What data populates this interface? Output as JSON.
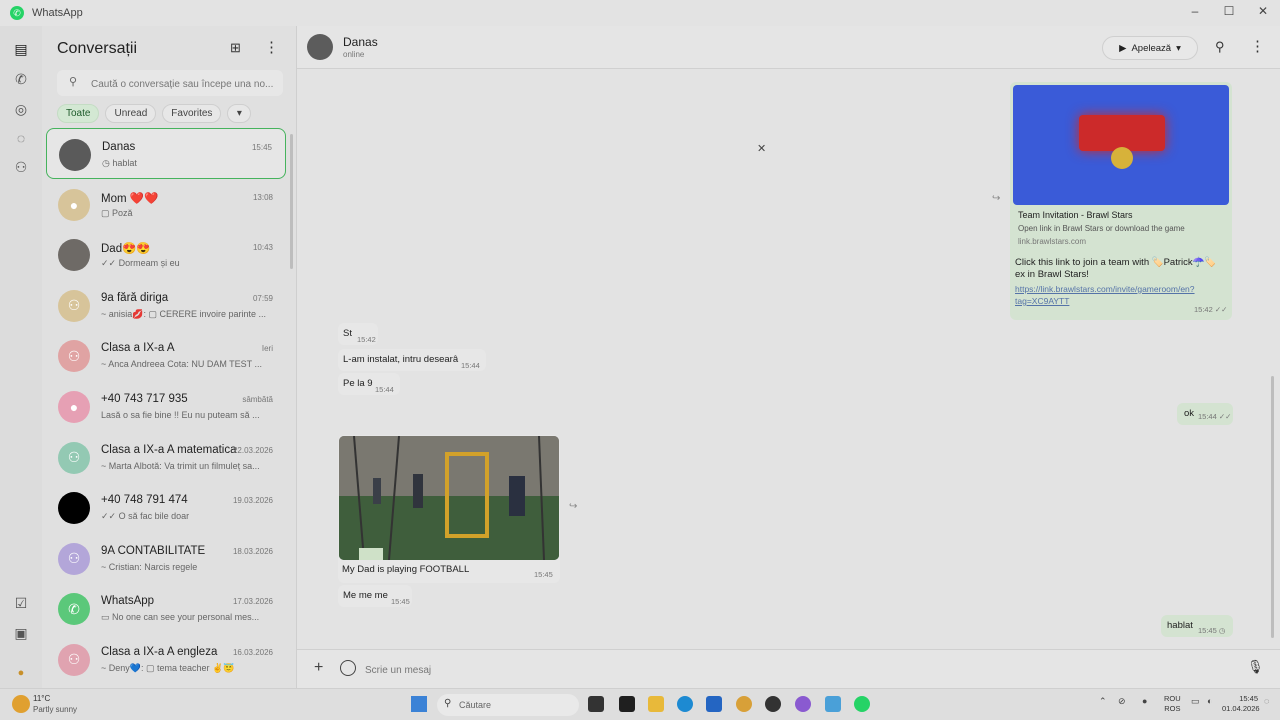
{
  "window": {
    "title": "WhatsApp",
    "controls": [
      "–",
      "☐",
      "✕"
    ]
  },
  "sidebar": {
    "title": "Conversații",
    "search_placeholder": "Caută o conversație sau începe una no...",
    "filters": [
      "Toate",
      "Unread",
      "Favorites",
      "▾"
    ],
    "chats": [
      {
        "name": "Danas",
        "time": "15:45",
        "preview": "◷ hablat",
        "avatar_color": "#5a5a5a",
        "selected": true
      },
      {
        "name": "Mom ❤️❤️",
        "time": "13:08",
        "preview": "▢ Poză",
        "avatar_color": "#d7c49a"
      },
      {
        "name": "Dad😍😍",
        "time": "10:43",
        "preview": "✓✓ Dormeam și eu",
        "avatar_color": "#6e6a66"
      },
      {
        "name": "9a fără diriga",
        "time": "07:59",
        "preview": "~ anisia💋: ▢ CERERE invoire parinte ...",
        "avatar_color": "#d7c49a"
      },
      {
        "name": "Clasa a IX-a A",
        "time": "Ieri",
        "preview": "~ Anca Andreea Cota: NU DAM TEST ...",
        "avatar_color": "#e0a3a3"
      },
      {
        "name": "+40 743 717 935",
        "time": "sâmbătă",
        "preview": "Lasă o sa fie bine !! Eu nu puteam să ...",
        "avatar_color": "#e6a0b4"
      },
      {
        "name": "Clasa a IX-a A matematica",
        "time": "22.03.2026",
        "preview": "~ Marta Albotă: Va trimit un filmuleț sa...",
        "avatar_color": "#93c9b3"
      },
      {
        "name": "+40 748 791 474",
        "time": "19.03.2026",
        "preview": "✓✓ O să fac bile doar",
        "avatar_color": "#000000"
      },
      {
        "name": "9A CONTABILITATE",
        "time": "18.03.2026",
        "preview": "~ Cristian: Narcis regele",
        "avatar_color": "#b3a6d9"
      },
      {
        "name": "WhatsApp",
        "time": "17.03.2026",
        "preview": "▭ No one can see your personal mes...",
        "avatar_color": "#5bc87a"
      },
      {
        "name": "Clasa a IX-a A engleza",
        "time": "16.03.2026",
        "preview": "~ Deny💙: ▢ tema teacher ✌️😇",
        "avatar_color": "#e0a3b0"
      }
    ]
  },
  "chat": {
    "contact_name": "Danas",
    "contact_status": "online",
    "call_label": "Apelează",
    "composer_placeholder": "Scrie un mesaj",
    "link_card": {
      "title": "Team Invitation - Brawl Stars",
      "description": "Open link in Brawl Stars or download the game",
      "domain": "link.brawlstars.com",
      "body": "Click this link to join a team with 🏷️Patrick☂️🏷️ ex in Brawl Stars!",
      "url": "https://link.brawlstars.com/invite/gameroom/en?tag=XC9AYTT",
      "time": "15:42 ✓✓"
    },
    "incoming": [
      {
        "text": "St",
        "time": "15:42"
      },
      {
        "text": "L-am instalat, intru desearâ",
        "time": "15:44"
      },
      {
        "text": "Pe la 9",
        "time": "15:44"
      }
    ],
    "ok_message": {
      "text": "ok",
      "time": "15:44 ✓✓"
    },
    "photo_message": {
      "caption": "My Dad is playing FOOTBALL",
      "time": "15:45"
    },
    "meme_message": {
      "text": "Me me me",
      "time": "15:45"
    },
    "last_message": {
      "text": "hablat",
      "time": "15:45 ◷"
    }
  },
  "taskbar": {
    "temperature": "11°C",
    "weather": "Partly sunny",
    "search_label": "Căutare",
    "lang_line1": "ROU",
    "lang_line2": "ROS",
    "time": "15:45",
    "date": "01.04.2026"
  }
}
